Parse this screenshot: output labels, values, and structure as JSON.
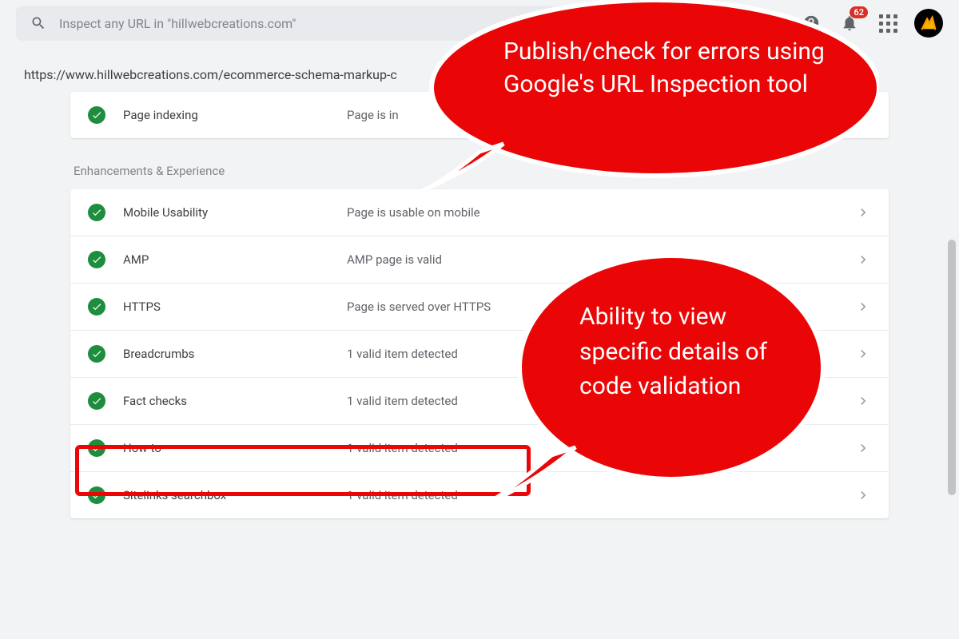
{
  "search": {
    "placeholder": "Inspect any URL in \"hillwebcreations.com\""
  },
  "notifications": {
    "count": "62"
  },
  "url": "https://www.hillwebcreations.com/ecommerce-schema-markup-c",
  "indexing": {
    "label": "Page indexing",
    "status": "Page is in"
  },
  "section_title": "Enhancements & Experience",
  "enhancements": [
    {
      "label": "Mobile Usability",
      "status": "Page is usable on mobile"
    },
    {
      "label": "AMP",
      "status": "AMP page is valid"
    },
    {
      "label": "HTTPS",
      "status": "Page is served over HTTPS"
    },
    {
      "label": "Breadcrumbs",
      "status": "1 valid item detected"
    },
    {
      "label": "Fact checks",
      "status": "1 valid item detected"
    },
    {
      "label": "How-to",
      "status": "1 valid item detected"
    },
    {
      "label": "Sitelinks searchbox",
      "status": "1 valid item detected"
    }
  ],
  "callouts": {
    "top": "Publish/check for errors using Google's URL Inspection tool",
    "bottom": "Ability to view specific details of code validation"
  }
}
